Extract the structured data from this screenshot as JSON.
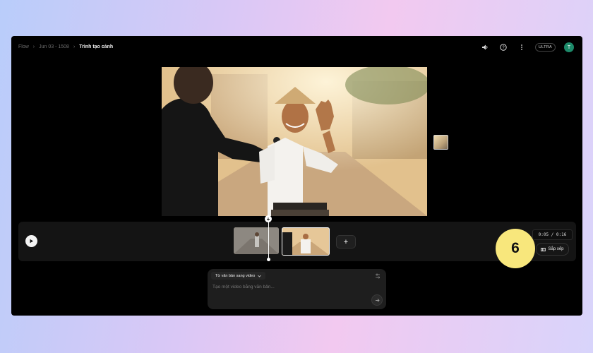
{
  "breadcrumb": {
    "root": "Flow",
    "project": "Jun 03 - 1508",
    "current": "Trình tạo cảnh"
  },
  "header": {
    "icons": [
      "speaker-icon",
      "help-circle-icon",
      "more-vertical-icon"
    ],
    "plan_badge": "ULTRA",
    "avatar_initial": "T",
    "avatar_color": "#1d8a6a"
  },
  "timeline": {
    "timecode": "0:05 / 0:16",
    "add_clip_label": "+",
    "arrange_label": "Sắp xếp",
    "clips": [
      "clip-1",
      "clip-2"
    ]
  },
  "step_badge": {
    "number": "6",
    "color": "#f8e77c"
  },
  "prompt": {
    "mode_label": "Từ văn bản sang video",
    "placeholder": "Tạo một video bằng văn bản..."
  }
}
